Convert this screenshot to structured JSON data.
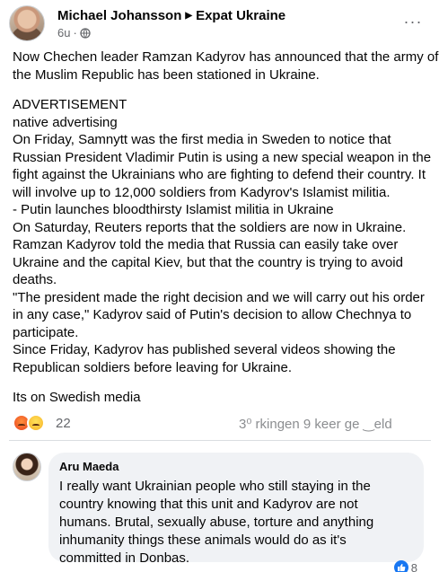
{
  "post": {
    "author": "Michael Johansson",
    "group": "Expat Ukraine",
    "time": "6u",
    "privacy_icon": "globe-icon",
    "more_icon": "ellipsis-icon",
    "more_label": "···",
    "lines": [
      "Now Chechen leader Ramzan Kadyrov has announced that the army of",
      "the Muslim Republic has been stationed in Ukraine.",
      "",
      "ADVERTISEMENT",
      "native advertising",
      "On Friday, Samnytt was the first media in Sweden to notice that",
      "Russian President Vladimir Putin is using a new special weapon in the",
      "fight against the Ukrainians who are fighting to defend their country. It",
      "will involve up to 12,000 soldiers from Kadyrov's Islamist militia.",
      " - Putin launches bloodthirsty Islamist militia in Ukraine",
      "On Saturday, Reuters reports that the soldiers are now in Ukraine.",
      "Ramzan Kadyrov told the media that Russia can easily take over",
      "Ukraine and the capital Kiev, but that the country is trying to avoid",
      "deaths.",
      "\"The president made the right decision and we will carry out his order",
      "in any case,\" Kadyrov said of Putin's decision to allow Chechnya to",
      "participate.",
      "Since Friday, Kadyrov has published several videos showing the",
      "Republican soldiers before leaving for Ukraine.",
      "",
      "Its on Swedish media"
    ]
  },
  "reactions": {
    "icons": [
      "angry-icon",
      "sad-icon"
    ],
    "count": "22",
    "stats_partial": "3⁰   rkingen  9 keer ge   ‿eld"
  },
  "comment": {
    "author": "Aru Maeda",
    "lines": [
      "I really want Ukrainian people who still staying in the",
      "country knowing that this unit and Kadyrov are not",
      "humans. Brutal, sexually abuse, torture and anything",
      "inhumanity things these animals would do as it's",
      "committed in Donbas."
    ],
    "like_count": "8"
  }
}
